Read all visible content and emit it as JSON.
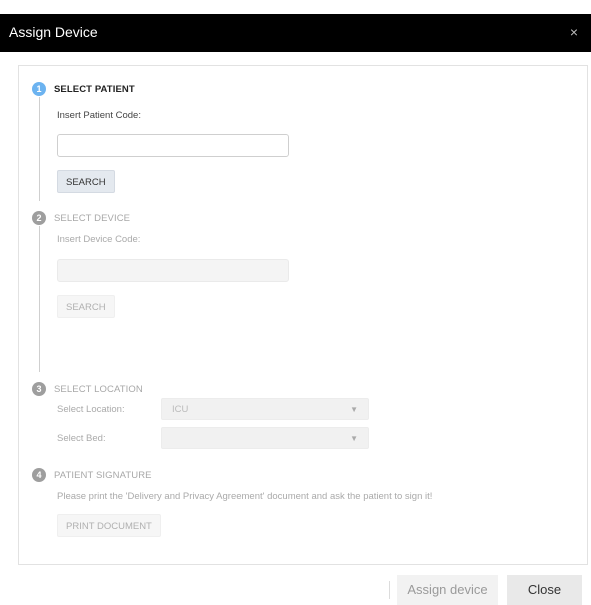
{
  "dialog": {
    "title": "Assign Device",
    "close_glyph": "×"
  },
  "steps": [
    {
      "number": "1",
      "title": "SELECT PATIENT",
      "field_label": "Insert Patient Code:",
      "input_value": "",
      "button_label": "SEARCH",
      "state": "active"
    },
    {
      "number": "2",
      "title": "SELECT DEVICE",
      "field_label": "Insert Device Code:",
      "input_value": "",
      "button_label": "SEARCH",
      "state": "disabled"
    },
    {
      "number": "3",
      "title": "SELECT LOCATION",
      "location_label": "Select Location:",
      "location_value": "ICU",
      "bed_label": "Select Bed:",
      "bed_value": "",
      "state": "disabled"
    },
    {
      "number": "4",
      "title": "PATIENT SIGNATURE",
      "instruction": "Please print the 'Delivery and Privacy Agreement' document and ask the patient to sign it!",
      "button_label": "PRINT DOCUMENT",
      "state": "disabled"
    }
  ],
  "footer": {
    "assign_label": "Assign device",
    "close_label": "Close"
  },
  "icons": {
    "caret": "▼"
  },
  "colors": {
    "titlebar_bg": "#000000",
    "active_step": "#6cb3f0",
    "inactive_step": "#9e9e9e"
  }
}
